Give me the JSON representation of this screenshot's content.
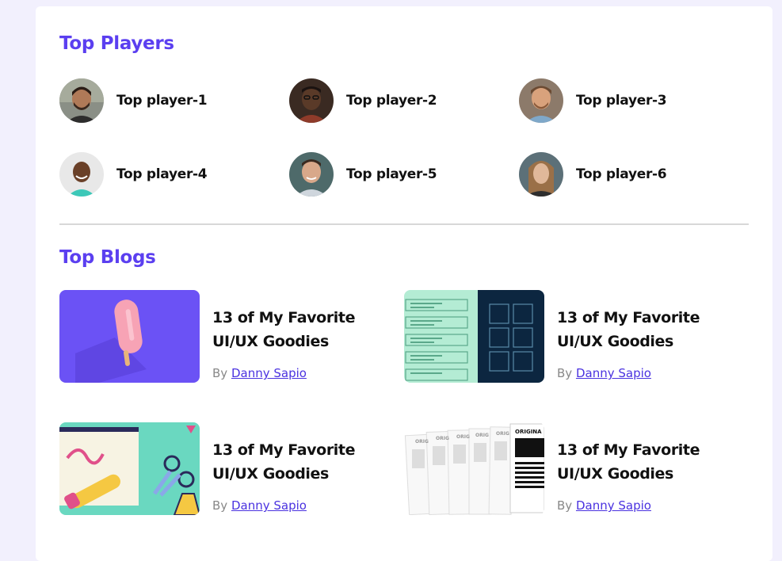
{
  "top_players": {
    "title": "Top Players",
    "players": [
      {
        "name": "Top player-1"
      },
      {
        "name": "Top player-2"
      },
      {
        "name": "Top player-3"
      },
      {
        "name": "Top player-4"
      },
      {
        "name": "Top player-5"
      },
      {
        "name": "Top player-6"
      }
    ]
  },
  "top_blogs": {
    "title": "Top Blogs",
    "by_label": "By",
    "blogs": [
      {
        "title": "13 of My Favorite UI/UX Goodies",
        "author": "Danny Sapio"
      },
      {
        "title": "13 of My Favorite UI/UX Goodies",
        "author": "Danny Sapio"
      },
      {
        "title": "13 of My Favorite UI/UX Goodies",
        "author": "Danny Sapio"
      },
      {
        "title": "13 of My Favorite UI/UX Goodies",
        "author": "Danny Sapio"
      }
    ]
  },
  "colors": {
    "accent": "#5b3ff0",
    "page_background": "#f2f0fd",
    "link": "#4a32e0"
  },
  "thumbnail_text": {
    "original_label": "ORIGINA",
    "original_label_short": "ORIG"
  }
}
